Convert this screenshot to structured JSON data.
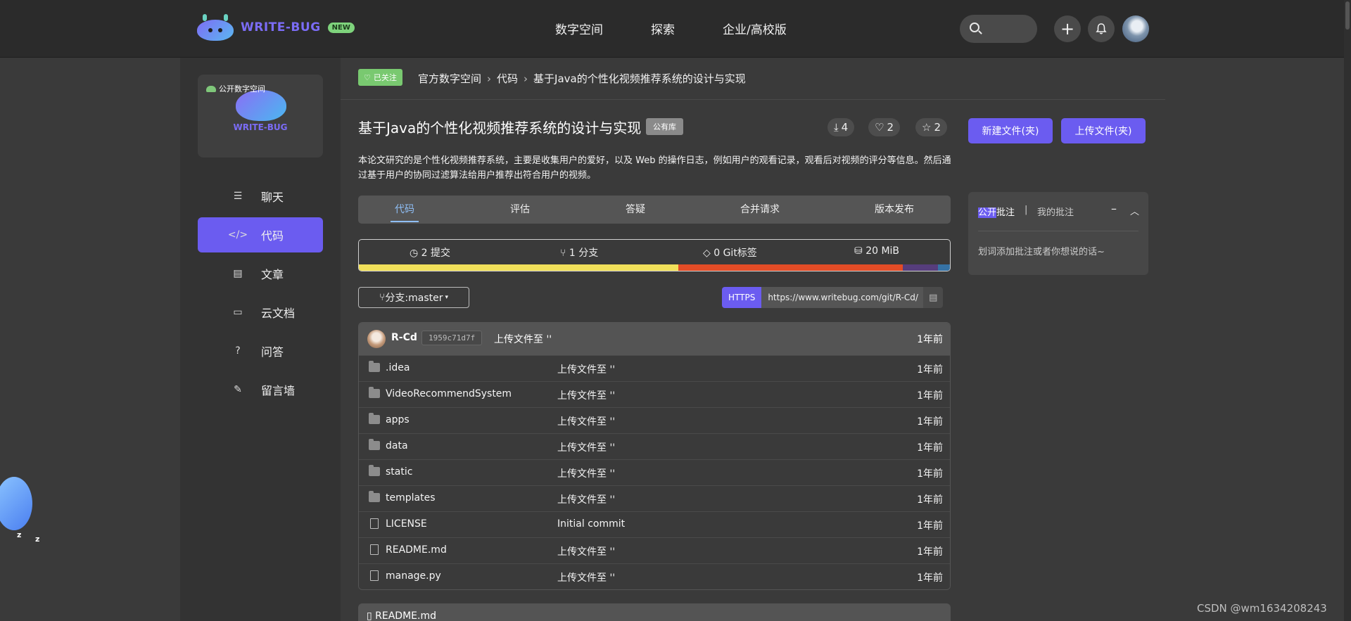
{
  "header": {
    "logo_text": "WRITE-BUG",
    "new_badge": "NEW",
    "nav": [
      "数字空间",
      "探索",
      "企业/高校版"
    ],
    "plus_icon": "+",
    "bell_icon": "bell-icon"
  },
  "sidebar": {
    "space_badge": "公开数字空间",
    "space_caption": "WRITE-BUG",
    "items": [
      {
        "label": "聊天",
        "icon": "chat-icon",
        "glyph": "☰"
      },
      {
        "label": "代码",
        "icon": "code-icon",
        "glyph": "</>"
      },
      {
        "label": "文章",
        "icon": "article-icon",
        "glyph": "▤"
      },
      {
        "label": "云文档",
        "icon": "folder-icon",
        "glyph": "▭"
      },
      {
        "label": "问答",
        "icon": "question-icon",
        "glyph": "?"
      },
      {
        "label": "留言墙",
        "icon": "edit-icon",
        "glyph": "✎"
      }
    ],
    "active_index": 1
  },
  "breadcrumb": {
    "follow_label": "已关注",
    "items": [
      "官方数字空间",
      "代码",
      "基于Java的个性化视频推荐系统的设计与实现"
    ]
  },
  "repo": {
    "title": "基于Java的个性化视频推荐系统的设计与实现",
    "visibility": "公有库",
    "downloads": "4",
    "likes": "2",
    "stars": "2",
    "new_button": "新建文件(夹)",
    "upload_button": "上传文件(夹)",
    "description": "本论文研究的是个性化视频推荐系统，主要是收集用户的爱好，以及 Web 的操作日志，例如用户的观看记录，观看后对视频的评分等信息。然后通过基于用户的协同过滤算法给用户推荐出符合用户的视频。"
  },
  "tabs": [
    "代码",
    "评估",
    "答疑",
    "合并请求",
    "版本发布"
  ],
  "stats": {
    "commits": "2 提交",
    "branches": "1 分支",
    "tags": "0 Git标签",
    "size": "20 MiB",
    "language_bar": [
      {
        "color": "#f1e05a",
        "percent": 54
      },
      {
        "color": "#e34c26",
        "percent": 38
      },
      {
        "color": "#563d7c",
        "percent": 6
      },
      {
        "color": "#3572a5",
        "percent": 2
      }
    ]
  },
  "branch_selector": "分支:master",
  "clone": {
    "protocol": "HTTPS",
    "url": "https://www.writebug.com/git/R-Cd/"
  },
  "latest_commit": {
    "author": "R-Cd",
    "hash": "1959c71d7f",
    "message": "上传文件至 ''",
    "time": "1年前"
  },
  "files": [
    {
      "name": ".idea",
      "type": "folder",
      "message": "上传文件至 ''",
      "time": "1年前"
    },
    {
      "name": "VideoRecommendSystem",
      "type": "folder",
      "message": "上传文件至 ''",
      "time": "1年前"
    },
    {
      "name": "apps",
      "type": "folder",
      "message": "上传文件至 ''",
      "time": "1年前"
    },
    {
      "name": "data",
      "type": "folder",
      "message": "上传文件至 ''",
      "time": "1年前"
    },
    {
      "name": "static",
      "type": "folder",
      "message": "上传文件至 ''",
      "time": "1年前"
    },
    {
      "name": "templates",
      "type": "folder",
      "message": "上传文件至 ''",
      "time": "1年前"
    },
    {
      "name": "LICENSE",
      "type": "file",
      "message": "Initial commit",
      "time": "1年前"
    },
    {
      "name": "README.md",
      "type": "file",
      "message": "上传文件至 ''",
      "time": "1年前"
    },
    {
      "name": "manage.py",
      "type": "file",
      "message": "上传文件至 ''",
      "time": "1年前"
    }
  ],
  "readme_title": "README.md",
  "annotations": {
    "public_hl": "公开",
    "public_rest": "批注",
    "divider": "|",
    "mine": "我的批注",
    "hint": "划词添加批注或者你想说的话~"
  },
  "watermark": "CSDN @wm1634208243"
}
